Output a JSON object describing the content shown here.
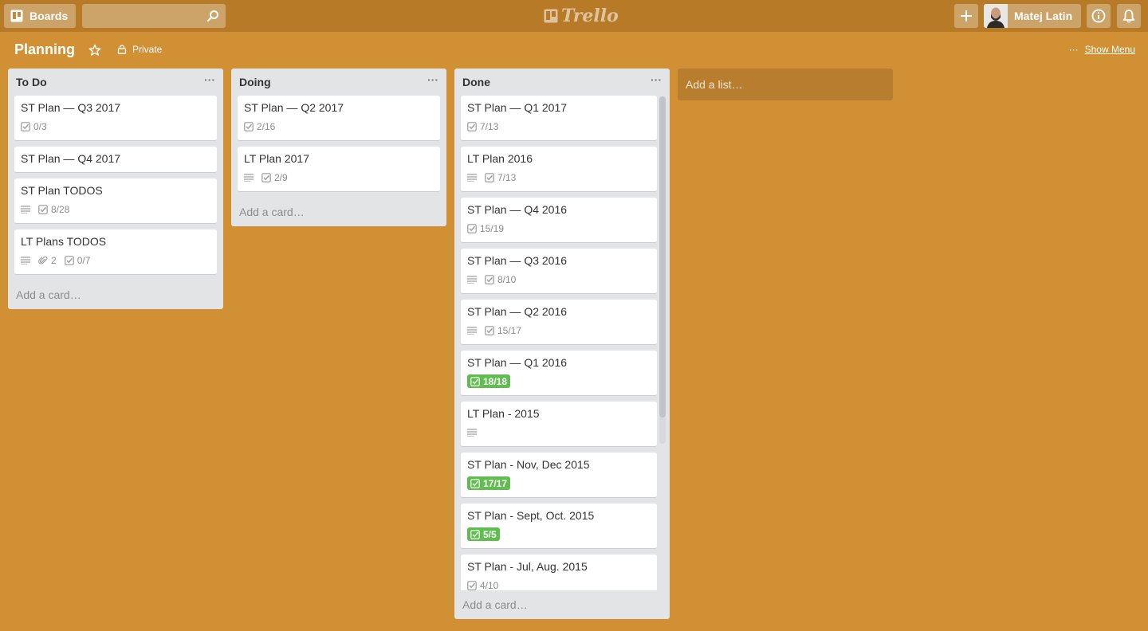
{
  "header": {
    "boards_label": "Boards",
    "search_placeholder": "",
    "logo_text": "Trello",
    "user_name": "Matej Latin"
  },
  "board": {
    "title": "Planning",
    "privacy": "Private",
    "menu_dots": "···",
    "show_menu": "Show Menu"
  },
  "lists": [
    {
      "title": "To Do",
      "menu": "···",
      "add_card": "Add a card…",
      "cards": [
        {
          "title": "ST Plan — Q3 2017",
          "desc": false,
          "attachments": "",
          "checklist": "0/3",
          "complete": false
        },
        {
          "title": "ST Plan — Q4 2017"
        },
        {
          "title": "ST Plan TODOS",
          "desc": true,
          "attachments": "",
          "checklist": "8/28",
          "complete": false
        },
        {
          "title": "LT Plans TODOS",
          "desc": true,
          "attachments": "2",
          "checklist": "0/7",
          "complete": false
        }
      ]
    },
    {
      "title": "Doing",
      "menu": "···",
      "add_card": "Add a card…",
      "cards": [
        {
          "title": "ST Plan — Q2 2017",
          "desc": false,
          "attachments": "",
          "checklist": "2/16",
          "complete": false
        },
        {
          "title": "LT Plan 2017",
          "desc": true,
          "attachments": "",
          "checklist": "2/9",
          "complete": false
        }
      ]
    },
    {
      "title": "Done",
      "menu": "···",
      "add_card": "Add a card…",
      "cards": [
        {
          "title": "ST Plan — Q1 2017",
          "desc": false,
          "attachments": "",
          "checklist": "7/13",
          "complete": false
        },
        {
          "title": "LT Plan 2016",
          "desc": true,
          "attachments": "",
          "checklist": "7/13",
          "complete": false
        },
        {
          "title": "ST Plan — Q4 2016",
          "desc": false,
          "attachments": "",
          "checklist": "15/19",
          "complete": false
        },
        {
          "title": "ST Plan — Q3 2016",
          "desc": true,
          "attachments": "",
          "checklist": "8/10",
          "complete": false
        },
        {
          "title": "ST Plan — Q2 2016",
          "desc": true,
          "attachments": "",
          "checklist": "15/17",
          "complete": false
        },
        {
          "title": "ST Plan — Q1 2016",
          "desc": false,
          "attachments": "",
          "checklist": "18/18",
          "complete": true
        },
        {
          "title": "LT Plan - 2015",
          "desc": true,
          "attachments": "",
          "checklist": "",
          "complete": false
        },
        {
          "title": "ST Plan - Nov, Dec 2015",
          "desc": false,
          "attachments": "",
          "checklist": "17/17",
          "complete": true
        },
        {
          "title": "ST Plan - Sept, Oct. 2015",
          "desc": false,
          "attachments": "",
          "checklist": "5/5",
          "complete": true
        },
        {
          "title": "ST Plan - Jul, Aug. 2015",
          "desc": false,
          "attachments": "",
          "checklist": "4/10",
          "complete": false
        }
      ]
    }
  ],
  "add_list": "Add a list…",
  "colors": {
    "board_bg": "#d29034",
    "header_bg": "#b77b28",
    "complete_badge": "#61bd4f"
  }
}
